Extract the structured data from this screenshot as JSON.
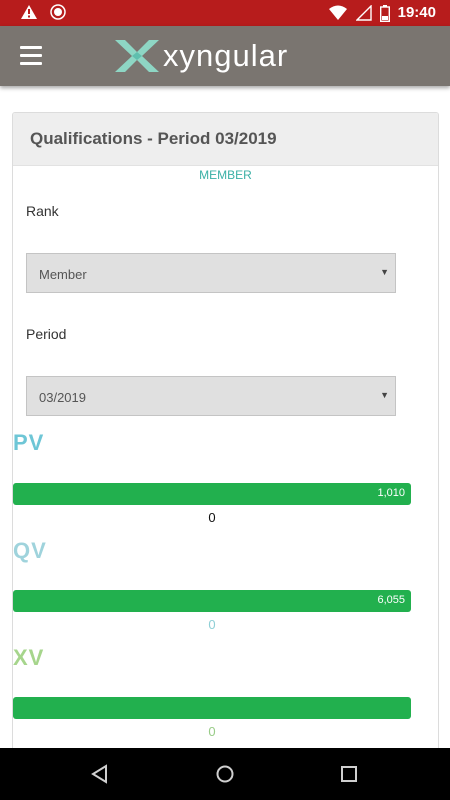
{
  "status_bar": {
    "time": "19:40",
    "left_icons": [
      "warning-icon",
      "app-notification-icon"
    ],
    "right_icons": [
      "wifi-icon",
      "signal-icon",
      "battery-icon"
    ]
  },
  "app_bar": {
    "brand": "xyngular",
    "background": "#7a7570"
  },
  "card": {
    "title": "Qualifications - Period 03/2019",
    "rank_badge": "MEMBER",
    "rank_label": "Rank",
    "rank_selected": "Member",
    "period_label": "Period",
    "period_selected": "03/2019"
  },
  "metrics": [
    {
      "label": "PV",
      "bar_value": "1,010",
      "progress": 1.0,
      "sub_value": "0",
      "label_color": "#6ec6d6",
      "sub_color": "#111111"
    },
    {
      "label": "QV",
      "bar_value": "6,055",
      "progress": 1.0,
      "sub_value": "0",
      "label_color": "#9fd3dc",
      "sub_color": "#8fcfd6"
    },
    {
      "label": "XV",
      "bar_value": "",
      "progress": 1.0,
      "sub_value": "0",
      "label_color": "#a6d58c",
      "sub_color": "#99cc88"
    }
  ],
  "colors": {
    "status_bar": "#b71c1c",
    "bar_fill": "#22b04e",
    "accent": "#3ab0a6"
  },
  "nav_bar": {
    "buttons": [
      "back-icon",
      "home-icon",
      "recents-icon"
    ]
  }
}
